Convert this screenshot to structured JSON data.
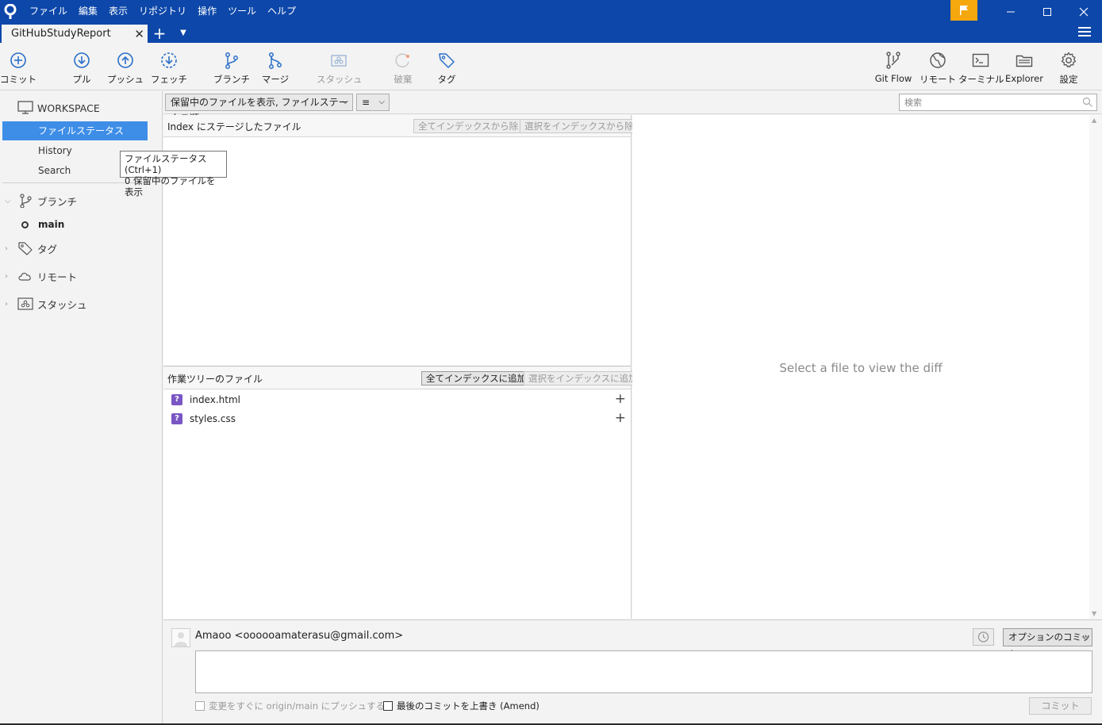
{
  "menu": [
    "ファイル",
    "編集",
    "表示",
    "リポジトリ",
    "操作",
    "ツール",
    "ヘルプ"
  ],
  "tab": {
    "title": "GitHubStudyReport"
  },
  "toolbar": {
    "commit": "コミット",
    "pull": "プル",
    "push": "プッシュ",
    "fetch": "フェッチ",
    "branch": "ブランチ",
    "merge": "マージ",
    "stash": "スタッシュ",
    "discard": "破棄",
    "tag": "タグ",
    "gitflow": "Git Flow",
    "remote": "リモート",
    "terminal": "ターミナル",
    "explorer": "Explorer",
    "settings": "設定"
  },
  "sidebar": {
    "workspace": "WORKSPACE",
    "file_status": "ファイルステータス",
    "history": "History",
    "search": "Search",
    "branches": "ブランチ",
    "current_branch": "main",
    "tags": "タグ",
    "remotes": "リモート",
    "stashes": "スタッシュ"
  },
  "tooltip": {
    "line1": "ファイルステータス (Ctrl+1)",
    "line2": "0 保留中のファイルを表示"
  },
  "filter": {
    "mode": "保留中のファイルを表示, ファイルステータス順",
    "view_icon": "≡",
    "search_placeholder": "検索"
  },
  "staged": {
    "title": "Index にステージしたファイル",
    "unstage_all": "全てインデックスから除く",
    "unstage_selected": "選択をインデックスから除く"
  },
  "unstaged": {
    "title": "作業ツリーのファイル",
    "stage_all": "全てインデックスに追加",
    "stage_selected": "選択をインデックスに追加",
    "files": [
      {
        "status": "?",
        "name": "index.html"
      },
      {
        "status": "?",
        "name": "styles.css"
      }
    ]
  },
  "diff": {
    "placeholder": "Select a file to view the diff"
  },
  "commit": {
    "author": "Amaoo <oooooamaterasu@gmail.com>",
    "options": "オプションのコミット",
    "push_immediately": "変更をすぐに origin/main にプッシュする",
    "amend": "最後のコミットを上書き (Amend)",
    "commit_button": "コミット"
  },
  "colors": {
    "titlebar": "#0d47a9",
    "accent": "#3e8ee8",
    "flag": "#f5a70e",
    "untracked": "#7a56c4"
  }
}
